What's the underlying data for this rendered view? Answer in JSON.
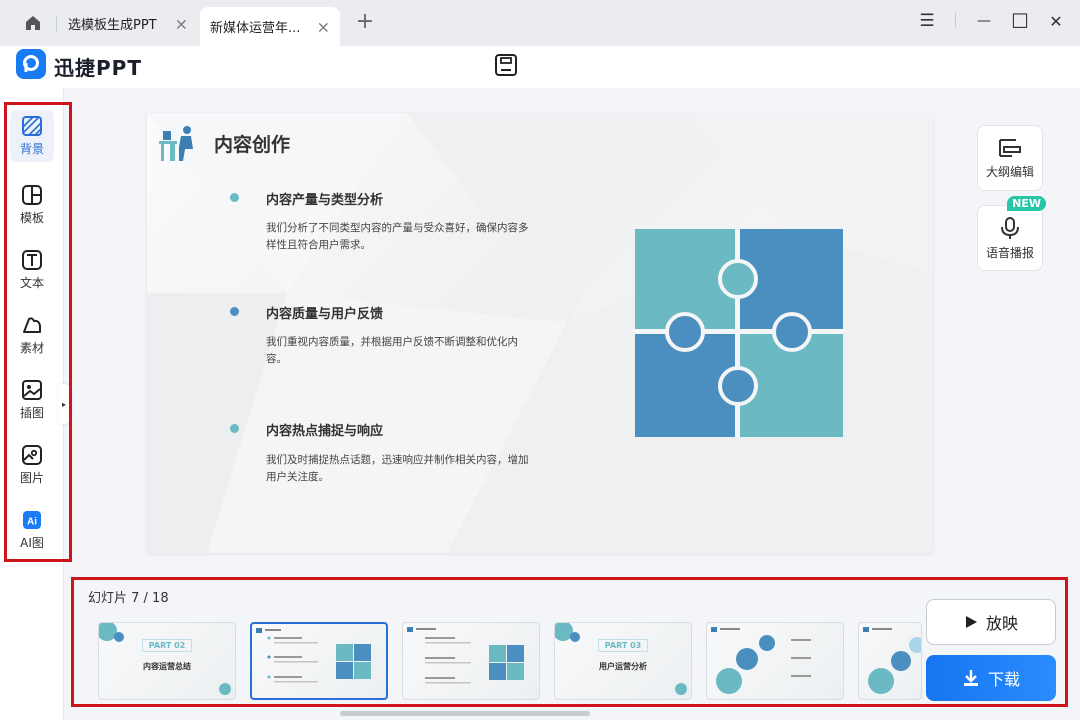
{
  "tabs": [
    {
      "label": "选模板生成PPT",
      "close": "×"
    },
    {
      "label": "新媒体运营年...",
      "close": "×"
    }
  ],
  "tab_add": "+",
  "window": {
    "menu": "☰",
    "minimize": "—",
    "maximize": "☐",
    "close": "✕"
  },
  "app": {
    "name": "迅捷PPT",
    "logo_icon": "logo-icon",
    "save_icon": "save-icon"
  },
  "sidebar": {
    "items": [
      {
        "label": "背景",
        "icon": "background-icon",
        "active": true
      },
      {
        "label": "模板",
        "icon": "template-icon"
      },
      {
        "label": "文本",
        "icon": "text-icon"
      },
      {
        "label": "素材",
        "icon": "material-icon"
      },
      {
        "label": "插图",
        "icon": "illustration-icon"
      },
      {
        "label": "图片",
        "icon": "image-icon"
      },
      {
        "label": "AI图",
        "icon": "ai-image-icon"
      }
    ],
    "collapse": "▸"
  },
  "slide": {
    "title": "内容创作",
    "points": [
      {
        "heading": "内容产量与类型分析",
        "body": "我们分析了不同类型内容的产量与受众喜好，确保内容多样性且符合用户需求。",
        "color": "#6bbac3"
      },
      {
        "heading": "内容质量与用户反馈",
        "body": "我们重视内容质量，并根据用户反馈不断调整和优化内容。",
        "color": "#4a8fc0"
      },
      {
        "heading": "内容热点捕捉与响应",
        "body": "我们及时捕捉热点话题，迅速响应并制作相关内容，增加用户关注度。",
        "color": "#6bbac3"
      }
    ],
    "puzzle_colors": [
      "#6bbac3",
      "#4a8fc0"
    ]
  },
  "right_tools": [
    {
      "label": "大纲编辑",
      "icon": "outline-icon"
    },
    {
      "label": "语音播报",
      "icon": "microphone-icon",
      "badge": "NEW"
    }
  ],
  "strip": {
    "counter": "幻灯片 7 / 18",
    "thumbs": [
      {
        "kind": "part",
        "part": "PART 02",
        "title": "内容运营总结"
      },
      {
        "kind": "content",
        "active": true
      },
      {
        "kind": "content"
      },
      {
        "kind": "part",
        "part": "PART 03",
        "title": "用户运营分析"
      },
      {
        "kind": "bubbles"
      },
      {
        "kind": "bubbles"
      }
    ]
  },
  "actions": {
    "play": "放映",
    "download": "下载"
  }
}
